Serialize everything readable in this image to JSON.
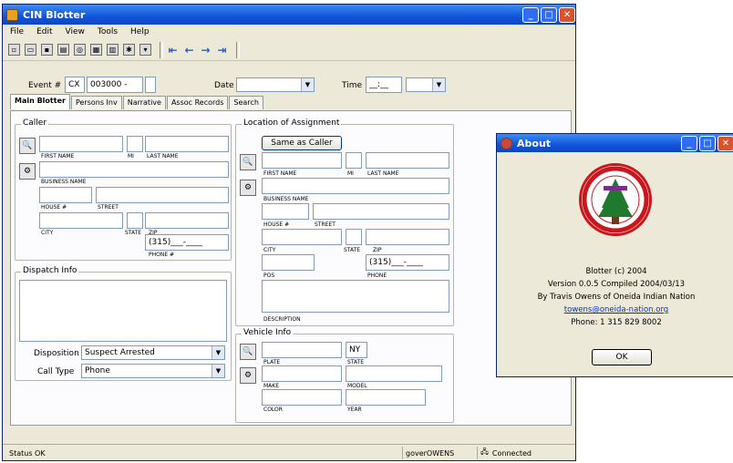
{
  "main": {
    "title": "CIN Blotter",
    "menu": [
      "File",
      "Edit",
      "View",
      "Tools",
      "Help"
    ],
    "event_label": "Event #",
    "event_prefix": "CX",
    "event_number": "003000 -",
    "date_label": "Date",
    "time_label": "Time",
    "time_value": "__:__",
    "tabs": [
      "Main Blotter",
      "Persons Inv",
      "Narrative",
      "Assoc Records",
      "Search"
    ],
    "caller": {
      "title": "Caller",
      "first_name": "FIRST NAME",
      "mi": "MI",
      "last_name": "LAST NAME",
      "business": "BUSINESS NAME",
      "house": "HOUSE #",
      "street": "STREET",
      "city": "CITY",
      "state": "STATE",
      "zip": "ZIP",
      "phone_value": "(315)___-____",
      "phone": "PHONE #"
    },
    "dispatch": {
      "title": "Dispatch Info",
      "disposition_label": "Disposition",
      "disposition_value": "Suspect Arrested",
      "call_type_label": "Call Type",
      "call_type_value": "Phone"
    },
    "location": {
      "title": "Location of Assignment",
      "same_as_caller": "Same as Caller",
      "first_name": "FIRST NAME",
      "mi": "MI",
      "last_name": "LAST NAME",
      "business": "BUSINESS NAME",
      "house": "HOUSE #",
      "street": "STREET",
      "city": "CITY",
      "state": "STATE",
      "zip": "ZIP",
      "phone_value": "(315)___-____",
      "pos": "POS",
      "phone": "PHONE",
      "description": "DESCRIPTION"
    },
    "vehicle": {
      "title": "Vehicle Info",
      "state_value": "NY",
      "plate": "PLATE",
      "state": "STATE",
      "make": "MAKE",
      "model": "MODEL",
      "color": "COLOR",
      "year": "YEAR"
    },
    "status": {
      "left": "Status OK",
      "user": "goverOWENS",
      "connection": "Connected"
    }
  },
  "about": {
    "title": "About",
    "line1": "Blotter (c) 2004",
    "line2": "Version 0.0.5  Compiled 2004/03/13",
    "line3": "By Travis Owens of Oneida Indian Nation",
    "email": "towens@oneida-nation.org",
    "phone": "Phone: 1 315 829 8002",
    "ok": "OK"
  }
}
